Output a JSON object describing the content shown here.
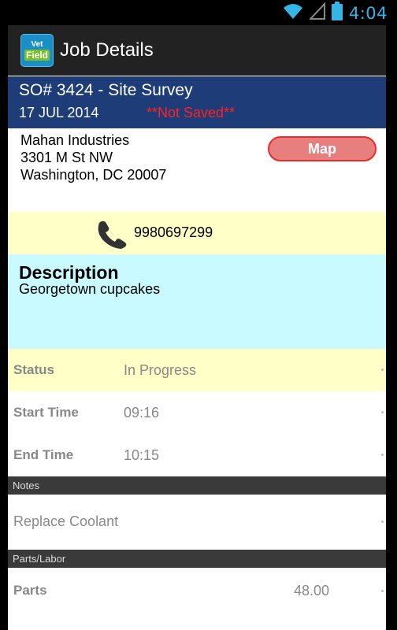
{
  "status_bar": {
    "time": "4:04",
    "icons": [
      "wifi-icon",
      "signal-icon",
      "battery-icon"
    ],
    "accent_color": "#33b5e5"
  },
  "app": {
    "logo_text_top": "Vet",
    "logo_text_bottom": "Field",
    "title": "Job Details"
  },
  "job": {
    "title": "SO# 3424 - Site Survey",
    "date": "17 JUL 2014",
    "save_status": "**Not Saved**",
    "header_color": "#1e3c78"
  },
  "address": {
    "line1": "Mahan Industries",
    "line2": "3301 M St NW",
    "line3": "Washington, DC 20007",
    "map_label": "Map"
  },
  "phone": {
    "number": "9980697299",
    "icon": "phone-icon"
  },
  "description": {
    "heading": "Description",
    "text": "Georgetown cupcakes"
  },
  "fields": {
    "status_label": "Status",
    "status_value": "In Progress",
    "start_label": "Start Time",
    "start_value": "09:16",
    "end_label": "End Time",
    "end_value": "10:15"
  },
  "sections": {
    "notes_header": "Notes",
    "notes_value": "Replace Coolant",
    "parts_header": "Parts/Labor",
    "parts_label": "Parts",
    "parts_value": "48.00"
  }
}
